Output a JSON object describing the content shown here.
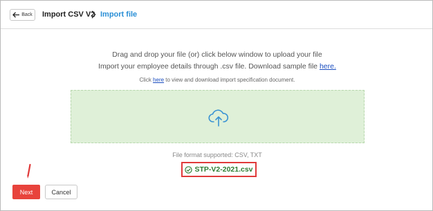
{
  "header": {
    "back_label": "Back",
    "title": "Import CSV V2",
    "breadcrumb_current": "Import file"
  },
  "upload": {
    "line1": "Drag and drop your file (or) click below window to upload your file",
    "line2_prefix": "Import your employee details through .csv file. Download sample file ",
    "line2_link": "here.",
    "line3_prefix": "Click ",
    "line3_link": "here",
    "line3_suffix": " to view and download import specification document.",
    "dropzone_icon": "cloud-upload-icon",
    "formats": "File format supported: CSV, TXT",
    "selected_file": "STP-V2-2021.csv",
    "selected_file_icon": "check-circle-icon"
  },
  "footer": {
    "next_label": "Next",
    "cancel_label": "Cancel"
  },
  "colors": {
    "accent_blue": "#2a8fd6",
    "dropzone_bg": "#dff0d8",
    "next_button": "#e8433c",
    "success_green": "#2e7d32",
    "highlight_red": "#e03a3a"
  }
}
